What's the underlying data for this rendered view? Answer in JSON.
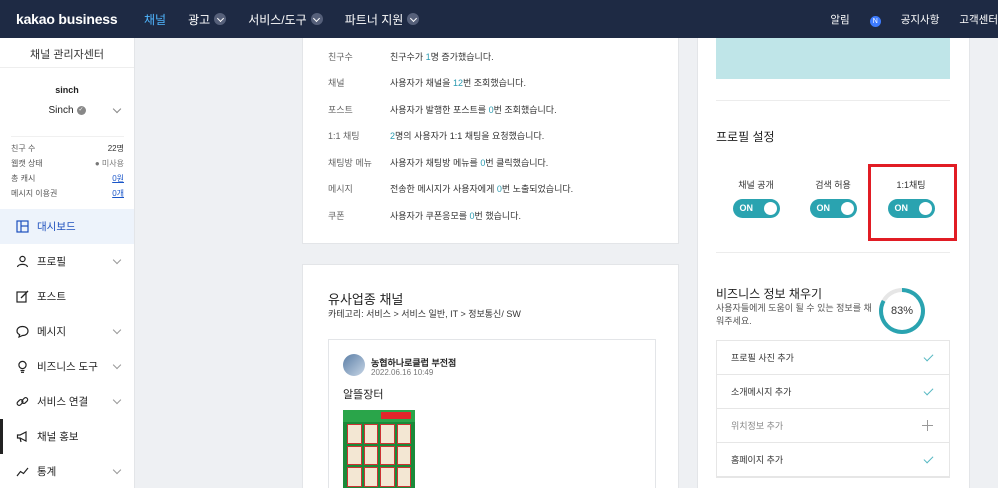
{
  "nav": {
    "logo": "kakao business",
    "items": [
      {
        "label": "채널",
        "active": true
      },
      {
        "label": "광고"
      },
      {
        "label": "서비스/도구"
      },
      {
        "label": "파트너 지원"
      }
    ],
    "right": {
      "alarm": "알림",
      "alarm_badge": "N",
      "notice": "공지사항",
      "support": "고객센터"
    }
  },
  "sidebar": {
    "title": "채널 관리자센터",
    "channel_logo": "sinch",
    "channel_name": "Sinch",
    "stats": [
      {
        "label": "친구 수",
        "value": "22명"
      },
      {
        "label": "웹캣 상태",
        "value": "미사용"
      },
      {
        "label": "총 캐시",
        "value": "0원"
      },
      {
        "label": "메시지 이용권",
        "value": "0개"
      }
    ],
    "menu": [
      {
        "label": "대시보드",
        "icon": "dashboard-icon",
        "active": true
      },
      {
        "label": "프로필",
        "icon": "person-icon"
      },
      {
        "label": "포스트",
        "icon": "edit-icon"
      },
      {
        "label": "메시지",
        "icon": "chat-bubble-icon"
      },
      {
        "label": "비즈니스 도구",
        "icon": "bulb-icon"
      },
      {
        "label": "서비스 연결",
        "icon": "link-icon"
      },
      {
        "label": "채널 홍보",
        "icon": "megaphone-icon"
      },
      {
        "label": "통계",
        "icon": "chart-icon"
      }
    ]
  },
  "activity": [
    {
      "label": "친구수",
      "pre": "친구수가 ",
      "num": "1",
      "post": "명 증가했습니다."
    },
    {
      "label": "채널",
      "pre": "사용자가 채널을 ",
      "num": "12",
      "post": "번 조회했습니다."
    },
    {
      "label": "포스트",
      "pre": "사용자가 발행한 포스트를 ",
      "num": "0",
      "post": "번 조회했습니다."
    },
    {
      "label": "1:1 채팅",
      "pre": "",
      "num": "2",
      "post": "명의 사용자가 1:1 채팅을 요청했습니다."
    },
    {
      "label": "채팅방 메뉴",
      "pre": "사용자가 채팅방 메뉴를 ",
      "num": "0",
      "post": "번 클릭했습니다."
    },
    {
      "label": "메시지",
      "pre": "전송한 메시지가 사용자에게 ",
      "num": "0",
      "post": "번 노출되었습니다."
    },
    {
      "label": "쿠폰",
      "pre": "사용자가 쿠폰응모를 ",
      "num": "0",
      "post": "번 했습니다."
    }
  ],
  "similar": {
    "title": "유사업종 채널",
    "category": "카테고리: 서비스 > 서비스 일반, IT > 정보통신/ SW",
    "post": {
      "author": "농협하나로클럽 부전점",
      "date": "2022.06.16 10:49",
      "text": "알뜰장터"
    }
  },
  "profile_settings": {
    "title": "프로필 설정",
    "toggles": [
      {
        "label": "채널 공개",
        "state": "ON"
      },
      {
        "label": "검색 허용",
        "state": "ON"
      },
      {
        "label": "1:1채팅",
        "state": "ON"
      }
    ]
  },
  "business_info": {
    "title": "비즈니스 정보 채우기",
    "desc": "사용자들에게 도움이 될 수 있는 정보를 채워주세요.",
    "percent_label": "83%",
    "percent": 83,
    "items": [
      {
        "label": "프로필 사진 추가",
        "done": true
      },
      {
        "label": "소개메시지 추가",
        "done": true
      },
      {
        "label": "위치정보 추가",
        "done": false
      },
      {
        "label": "홈페이지 추가",
        "done": true
      }
    ]
  },
  "colors": {
    "nav_bg": "#1e2a44",
    "accent": "#2aa3b0",
    "highlight_box": "#e11c24"
  }
}
